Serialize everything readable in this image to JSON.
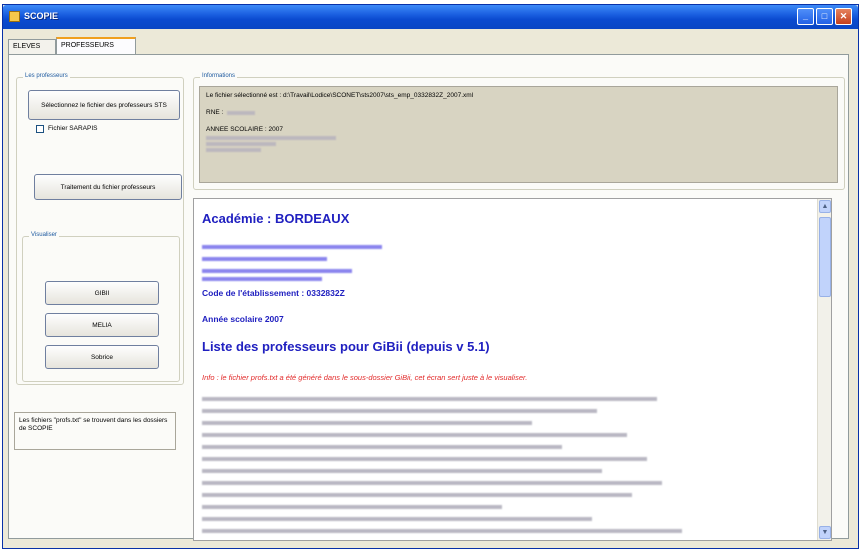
{
  "window": {
    "title": "SCOPIE"
  },
  "tabs": [
    {
      "label": "ELEVES"
    },
    {
      "label": "PROFESSEURS"
    }
  ],
  "left_panel": {
    "group_title": "Les professeurs",
    "select_file_button": "Sélectionnez le fichier des professeurs STS",
    "sarapis_checkbox": {
      "label": "Fichier SARAPIS",
      "checked": false
    },
    "process_button": "Traitement du fichier professeurs",
    "visualiser": {
      "title": "Visualiser",
      "buttons": [
        "GIBII",
        "MELIA",
        "Sobrice"
      ]
    },
    "note": "Les fichiers \"profs.txt\" se trouvent dans les dossiers de SCOPIE"
  },
  "informations": {
    "title": "Informations",
    "file_line": "Le fichier sélectionné est : d:\\Travail\\Lodice\\SCONET\\sts2007\\sts_emp_0332832Z_2007.xml",
    "rne_label": "RNE :",
    "annee_line": "ANNEE SCOLAIRE : 2007"
  },
  "content": {
    "academie": "Académie : BORDEAUX",
    "code_etablissement": "Code de l'établissement : 0332832Z",
    "annee_scolaire": "Année scolaire 2007",
    "liste_title": "Liste des professeurs pour GiBii (depuis v 5.1)",
    "info_red": "Info : le fichier profs.txt a été généré dans le sous-dossier GiBii, cet écran sert juste à le visualiser."
  },
  "colors": {
    "title_blue": "#2020c0",
    "info_red": "#e22a2a",
    "titlebar": "#0b4bd0"
  }
}
